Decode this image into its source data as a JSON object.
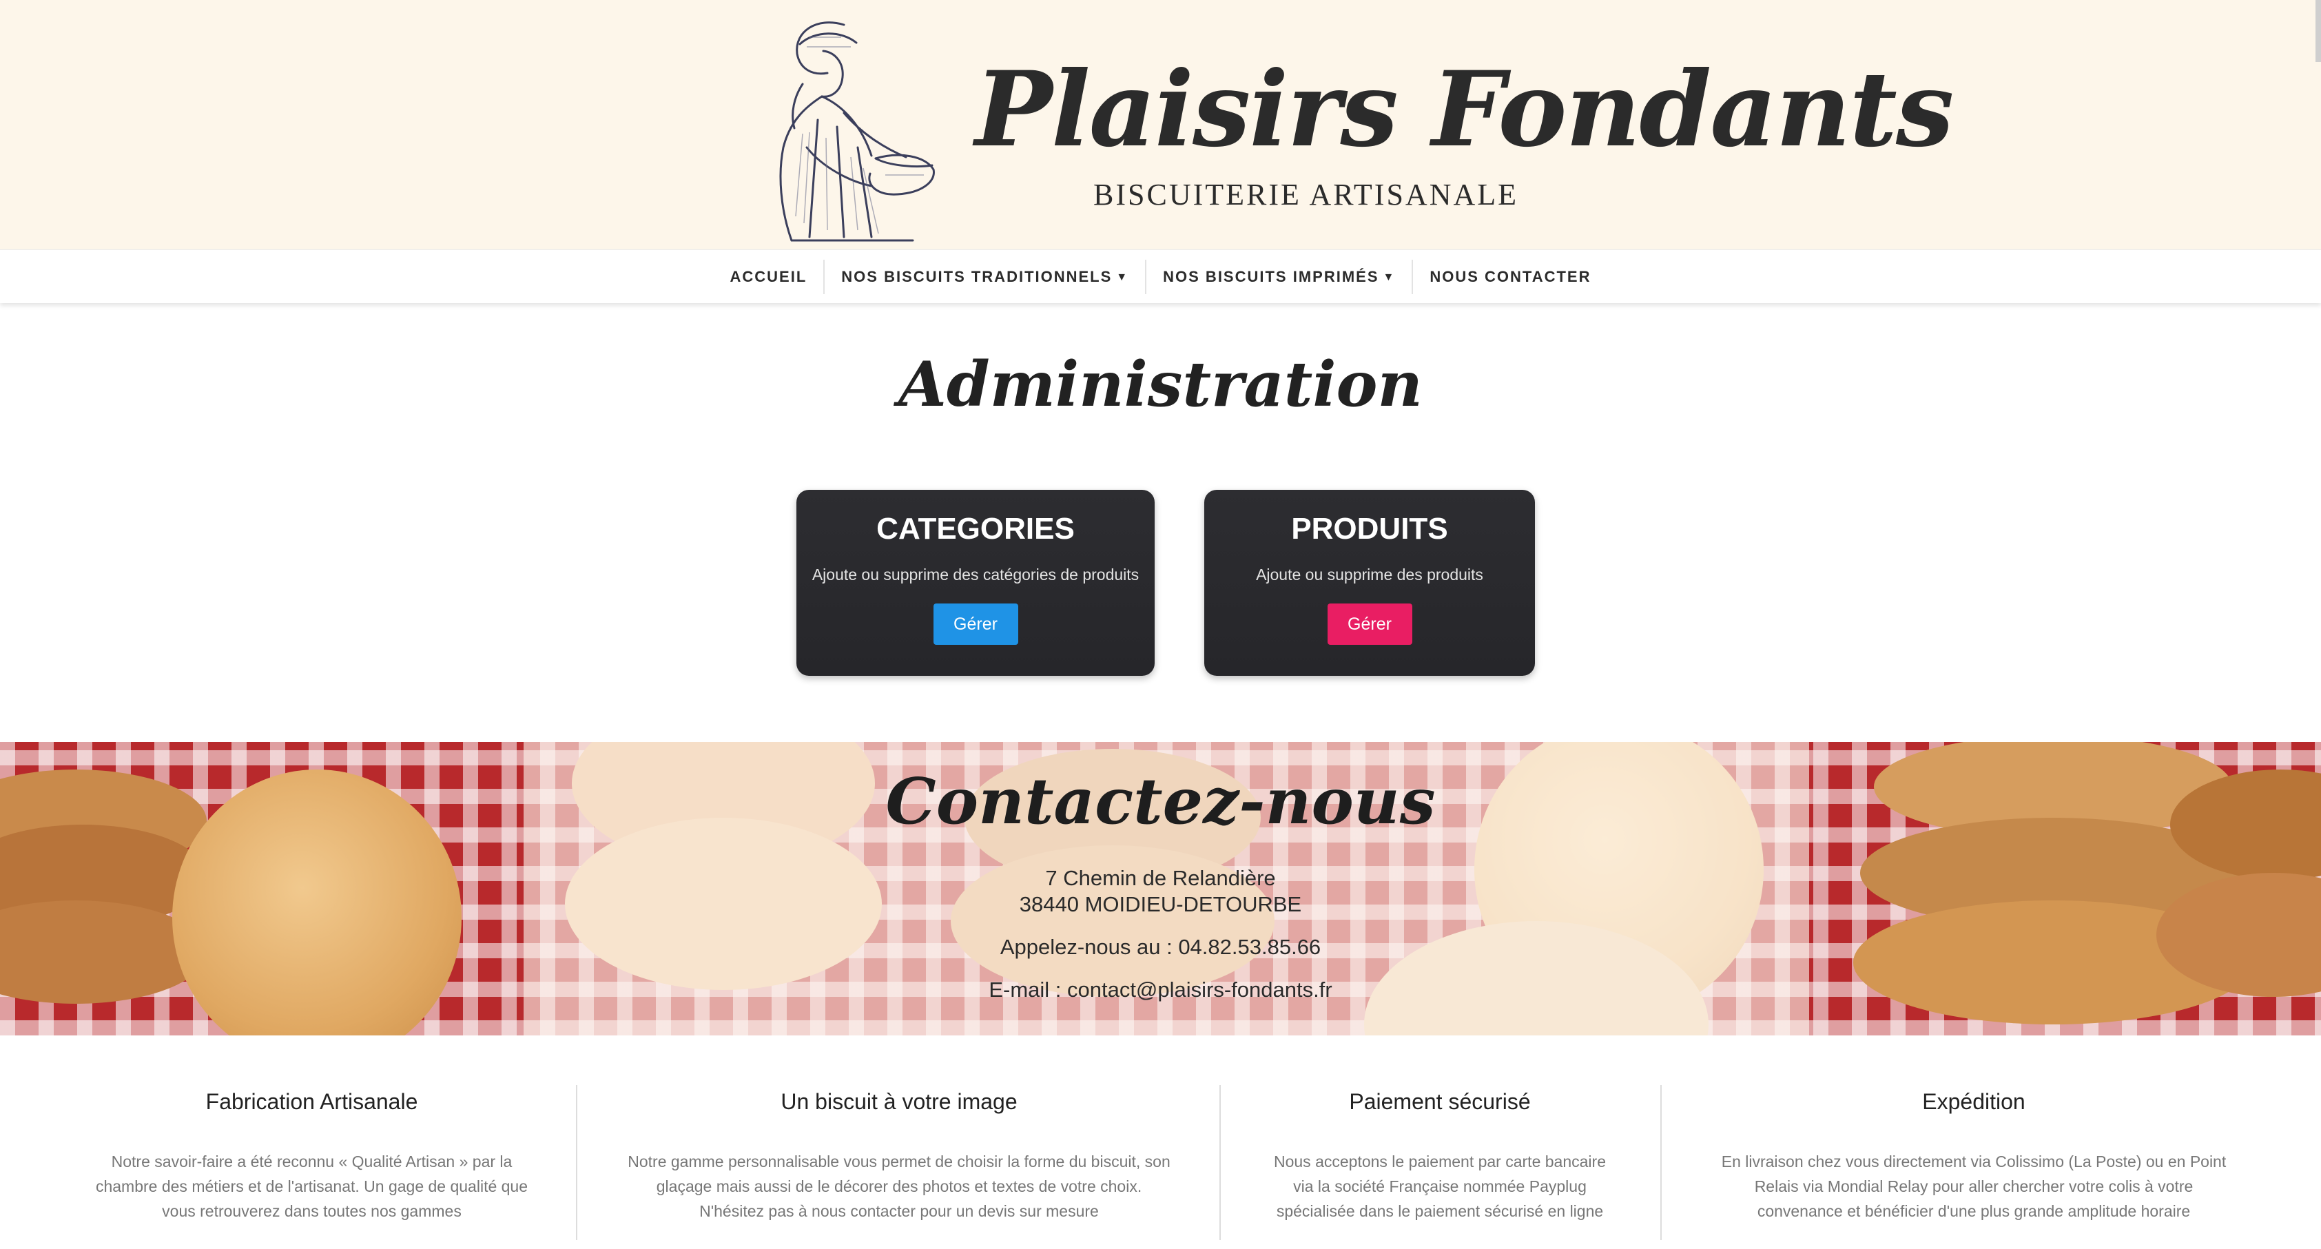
{
  "brand": {
    "name": "Plaisirs Fondants",
    "tagline": "BISCUITERIE ARTISANALE"
  },
  "nav": {
    "items": [
      {
        "label": "ACCUEIL",
        "dropdown": false
      },
      {
        "label": "NOS BISCUITS TRADITIONNELS",
        "dropdown": true
      },
      {
        "label": "NOS BISCUITS IMPRIMÉS",
        "dropdown": true
      },
      {
        "label": "NOUS CONTACTER",
        "dropdown": false
      }
    ]
  },
  "admin": {
    "title": "Administration",
    "cards": [
      {
        "title": "CATEGORIES",
        "description": "Ajoute ou supprime des catégories de produits",
        "button": "Gérer",
        "button_color": "#1f93e6"
      },
      {
        "title": "PRODUITS",
        "description": "Ajoute ou supprime des produits",
        "button": "Gérer",
        "button_color": "#e91e63"
      }
    ]
  },
  "contact": {
    "title": "Contactez-nous",
    "address_line1": "7 Chemin de Relandière",
    "address_line2": "38440 MOIDIEU-DETOURBE",
    "phone": "Appelez-nous au : 04.82.53.85.66",
    "email": "E-mail : contact@plaisirs-fondants.fr"
  },
  "features": [
    {
      "title": "Fabrication Artisanale",
      "lines": [
        "Notre savoir-faire a été reconnu « Qualité Artisan » par la",
        "chambre des métiers et de l'artisanat. Un gage de qualité que",
        "vous retrouverez dans toutes nos gammes"
      ]
    },
    {
      "title": "Un biscuit à votre image",
      "lines": [
        "Notre gamme personnalisable vous permet de choisir la forme du biscuit, son",
        "glaçage mais aussi de le décorer des photos et textes de votre choix.",
        "N'hésitez pas à nous contacter pour un devis sur mesure"
      ]
    },
    {
      "title": "Paiement sécurisé",
      "lines": [
        "Nous acceptons le paiement par carte bancaire",
        "via la société Française nommée Payplug",
        "spécialisée dans le paiement sécurisé en ligne"
      ]
    },
    {
      "title": "Expédition",
      "lines": [
        "En livraison chez vous directement via Colissimo (La Poste) ou en Point",
        "Relais via Mondial Relay pour aller chercher votre colis à votre",
        "convenance et bénéficier d'une plus grande amplitude horaire"
      ]
    }
  ],
  "colors": {
    "header_bg": "#fdf6ea",
    "card_bg": "#2b2b2f",
    "accent_blue": "#1f93e6",
    "accent_pink": "#e91e63"
  }
}
